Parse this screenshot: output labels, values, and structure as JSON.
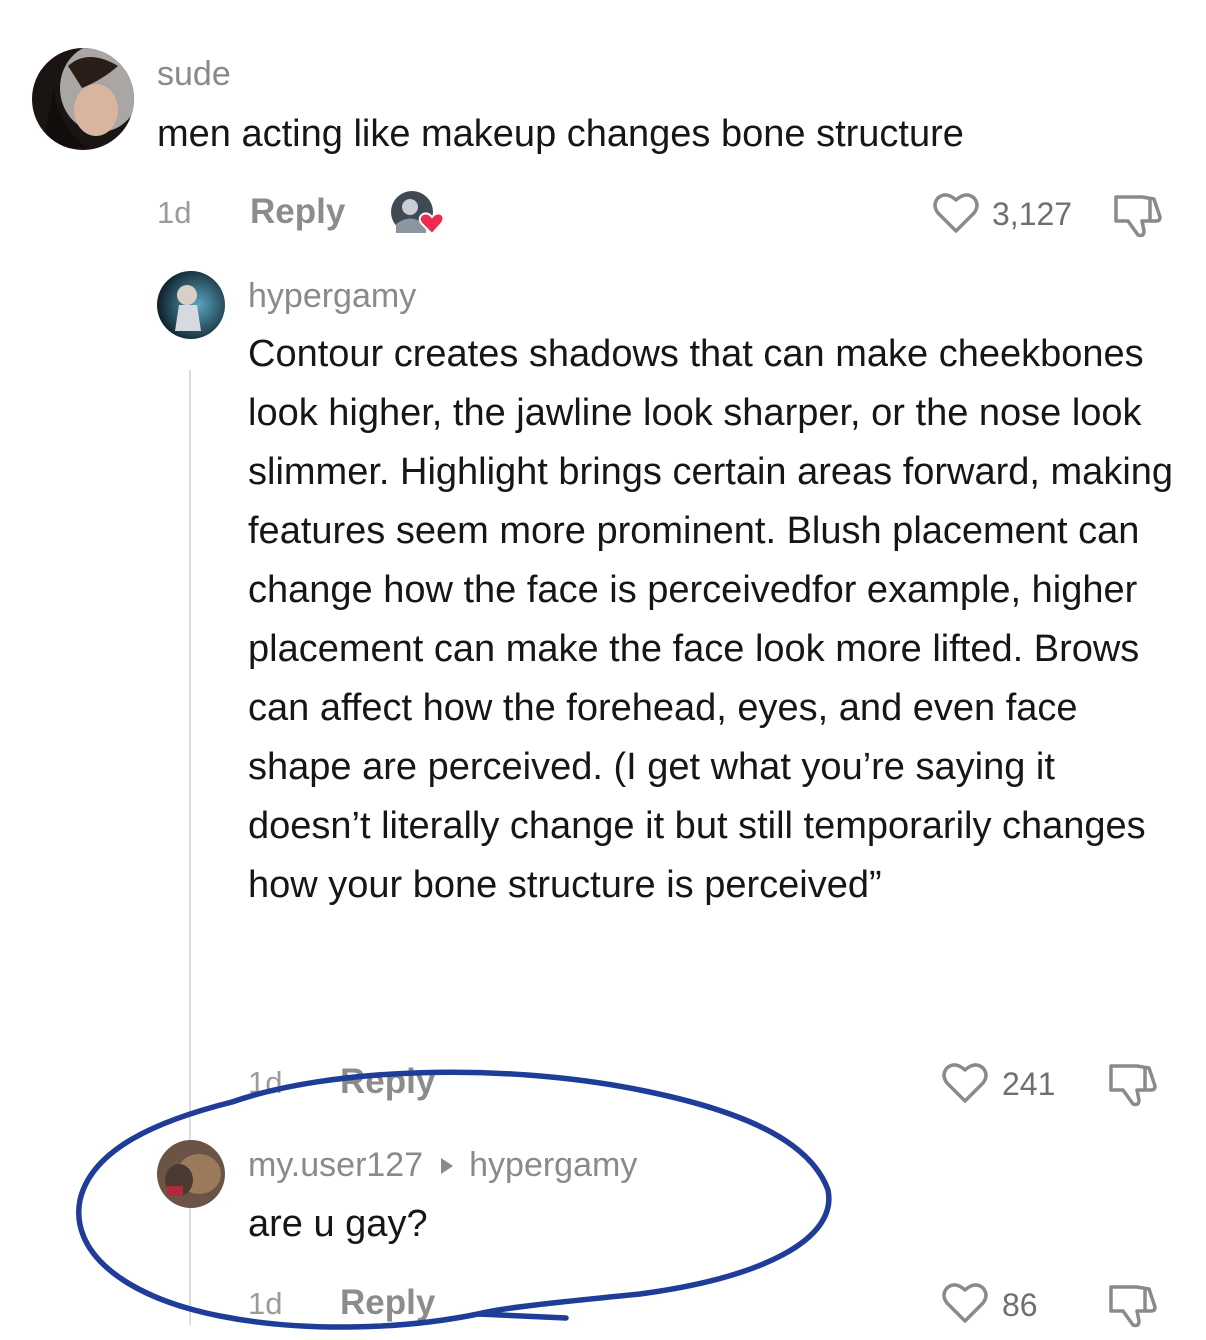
{
  "comments": [
    {
      "username": "sude",
      "text": "men acting like makeup changes bone structure",
      "time": "1d",
      "reply_label": "Reply",
      "likes": "3,127"
    },
    {
      "username": "hypergamy",
      "text": "Contour creates shadows that can make cheekbones look higher, the jawline look sharper, or the nose look slimmer. Highlight brings certain areas forward, making features seem more prominent. Blush placement can change how the face is perceivedfor example, higher placement can make the face look more lifted. Brows can affect how the forehead, eyes, and even face shape are perceived. (I get what you’re saying it doesn’t literally change it but still temporarily changes how your bone structure is perceived”",
      "time": "1d",
      "reply_label": "Reply",
      "likes": "241"
    },
    {
      "username": "my.user127",
      "reply_to": "hypergamy",
      "text": "are u gay?",
      "time": "1d",
      "reply_label": "Reply",
      "likes": "86"
    }
  ],
  "colors": {
    "annotation_circle": "#1f3c98",
    "creator_heart": "#ee2a4f"
  },
  "icons": [
    "heart-outline-icon",
    "thumbs-down-icon",
    "creator-liked-icon",
    "reply-to-arrow-icon"
  ]
}
